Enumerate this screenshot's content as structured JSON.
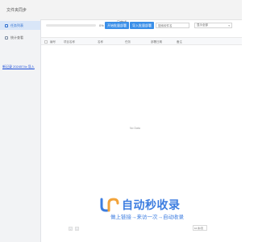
{
  "app": {
    "title": "文件夹同步"
  },
  "sidebar": {
    "items": [
      {
        "label": "任务列表"
      },
      {
        "label": "统计查看"
      }
    ],
    "link_text": "新记录 2024574x 导入"
  },
  "toolbar": {
    "progress_percent": 0,
    "progress_text": "0%",
    "done_label": "已完成 (0)",
    "btn_primary": "开始批量部署",
    "btn_secondary": "导入批量部署",
    "search_placeholder": "搜索软件名",
    "select_value": "显示全部"
  },
  "table": {
    "columns": [
      "编号",
      "项目名称",
      "名称",
      "任务",
      "部署日期",
      "备注"
    ],
    "empty_text": "No Data"
  },
  "watermark": {
    "main": "自动秒收录",
    "sub": "做上链接→来访一次→自动收录"
  },
  "pager": {
    "prev": "‹",
    "next": "›",
    "page_size": "10 条/页"
  },
  "colors": {
    "accent": "#3b8fe8",
    "sidebar_active_bg": "#d9e6f8",
    "link": "#1d4fd8"
  }
}
